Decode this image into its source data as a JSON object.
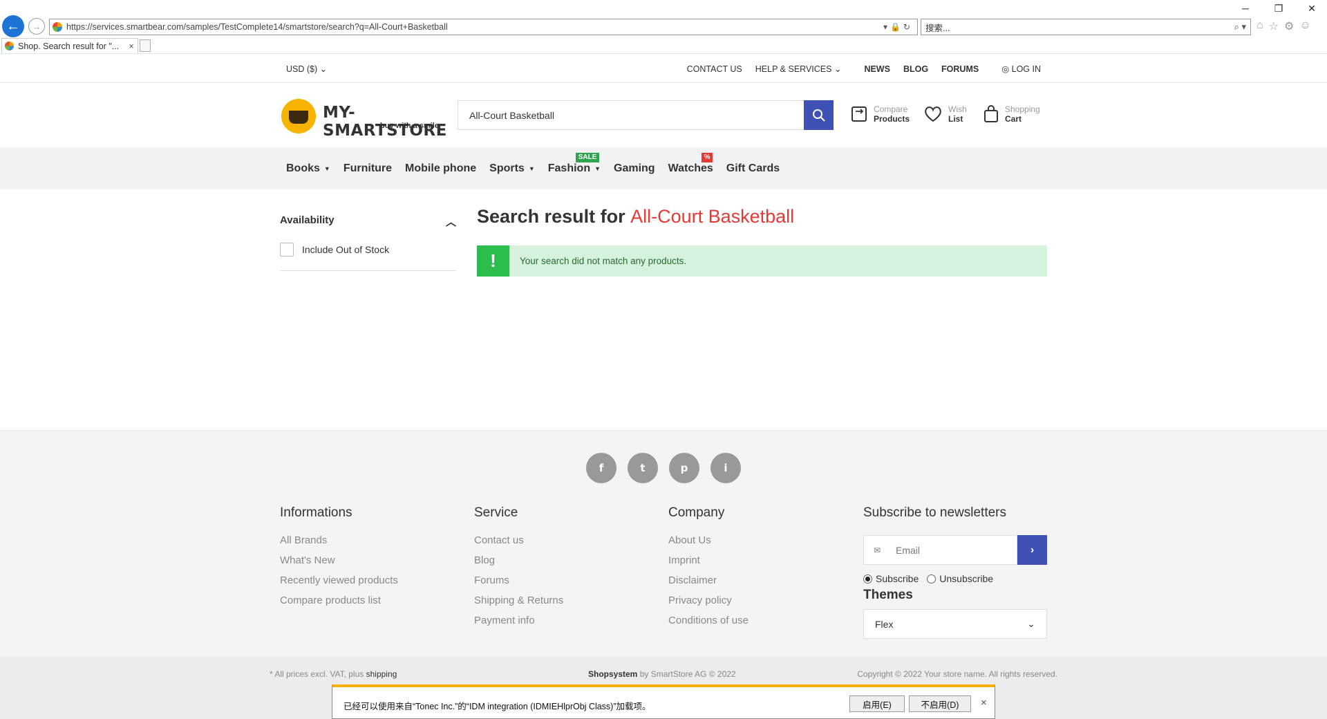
{
  "browser": {
    "url": "https://services.smartbear.com/samples/TestComplete14/smartstore/search?q=All-Court+Basketball",
    "search_placeholder": "搜索...",
    "tab_title": "Shop. Search result for \"...",
    "window_controls": [
      "─",
      "❐",
      "✕"
    ]
  },
  "topbar": {
    "currency": "USD  ($)",
    "links": [
      "CONTACT US",
      "HELP & SERVICES",
      "NEWS",
      "BLOG",
      "FORUMS"
    ],
    "login": "LOG IN"
  },
  "header": {
    "logo_name": "MY-SMARTSTORE",
    "logo_tagline": "buy with a smile",
    "search_value": "All-Court Basketball",
    "compare": {
      "l1": "Compare",
      "l2": "Products"
    },
    "wish": {
      "l1": "Wish",
      "l2": "List"
    },
    "cart": {
      "l1": "Shopping",
      "l2": "Cart"
    }
  },
  "catnav": {
    "items": [
      "Books",
      "Furniture",
      "Mobile phone",
      "Sports",
      "Fashion",
      "Gaming",
      "Watches",
      "Gift Cards"
    ],
    "badge_sale": "SALE",
    "badge_pct": "%"
  },
  "sidebar": {
    "heading": "Availability",
    "option": "Include Out of Stock"
  },
  "main": {
    "title_prefix": "Search result for ",
    "query": "All-Court Basketball",
    "alert_icon": "!",
    "alert_message": "Your search did not match any products."
  },
  "footer": {
    "social": [
      "f",
      "t",
      "p",
      "i"
    ],
    "informations": {
      "title": "Informations",
      "links": [
        "All Brands",
        "What's New",
        "Recently viewed products",
        "Compare products list"
      ]
    },
    "service": {
      "title": "Service",
      "links": [
        "Contact us",
        "Blog",
        "Forums",
        "Shipping & Returns",
        "Payment info"
      ]
    },
    "company": {
      "title": "Company",
      "links": [
        "About Us",
        "Imprint",
        "Disclaimer",
        "Privacy policy",
        "Conditions of use"
      ]
    },
    "newsletter": {
      "title": "Subscribe to newsletters",
      "email_placeholder": "Email",
      "subscribe": "Subscribe",
      "unsubscribe": "Unsubscribe"
    },
    "themes": {
      "title": "Themes",
      "selected": "Flex"
    }
  },
  "bottombar": {
    "prices_note": "* All prices excl. VAT, plus ",
    "shipping_link": "shipping",
    "shopsystem": "Shopsystem",
    "by": " by SmartStore AG © 2022",
    "copyright": "Copyright © 2022 Your store name. All rights reserved."
  },
  "notification": {
    "message": "已经可以使用来自“Tonec Inc.”的“IDM integration (IDMIEHlprObj Class)”加载项。",
    "enable": "启用(E)",
    "disable": "不启用(D)",
    "close": "×"
  },
  "colors": {
    "accent": "#3f51b5",
    "query_red": "#e53935",
    "alert_green": "#2dbd4e",
    "alert_bg": "#d7f2dc",
    "sale_green": "#2ea44f"
  }
}
